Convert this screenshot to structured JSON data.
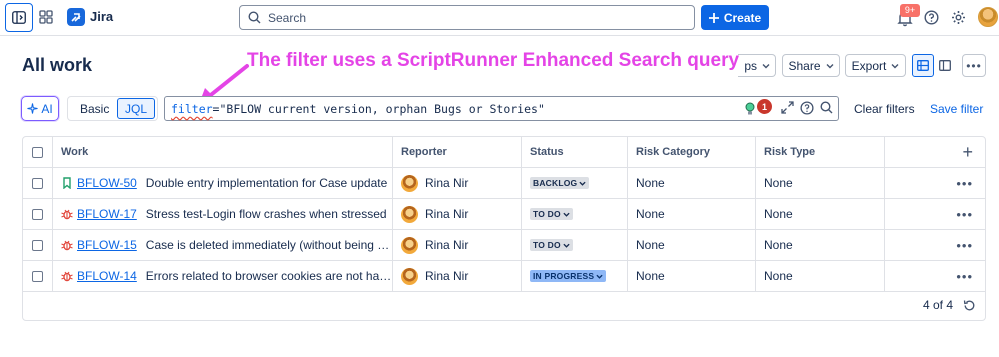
{
  "app": {
    "name": "Jira"
  },
  "topbar": {
    "search_placeholder": "Search",
    "create_label": "Create",
    "notification_count": "9+"
  },
  "page": {
    "title": "All work",
    "annotation": "The filter uses a ScriptRunner Enhanced Search query"
  },
  "header_buttons": {
    "apps": "ps",
    "share": "Share",
    "export": "Export"
  },
  "query": {
    "ai_label": "AI",
    "basic_label": "Basic",
    "jql_label": "JQL",
    "keyword": "filter",
    "rest": "=\"BFLOW current version, orphan Bugs or Stories\"",
    "error_count": "1",
    "clear_filters": "Clear filters",
    "save_filter": "Save filter"
  },
  "table": {
    "columns": [
      "Work",
      "Reporter",
      "Status",
      "Risk Category",
      "Risk Type"
    ],
    "rows": [
      {
        "type": "story",
        "key": "BFLOW-50",
        "summary": "Double entry implementation for Case update",
        "reporter": "Rina Nir",
        "status": "BACKLOG",
        "risk_category": "None",
        "risk_type": "None"
      },
      {
        "type": "bug",
        "key": "BFLOW-17",
        "summary": "Stress test-Login flow crashes when stressed",
        "reporter": "Rina Nir",
        "status": "TO DO",
        "risk_category": "None",
        "risk_type": "None"
      },
      {
        "type": "bug",
        "key": "BFLOW-15",
        "summary": "Case is deleted immediately (without being trash...",
        "reporter": "Rina Nir",
        "status": "TO DO",
        "risk_category": "None",
        "risk_type": "None"
      },
      {
        "type": "bug",
        "key": "BFLOW-14",
        "summary": "Errors related to browser cookies are not handled...",
        "reporter": "Rina Nir",
        "status": "IN PROGRESS",
        "risk_category": "None",
        "risk_type": "None"
      }
    ],
    "footer_count": "4 of 4"
  },
  "colors": {
    "accent": "#0c66e4",
    "annotation": "#e444e6",
    "bug": "#e2483d",
    "story": "#22a06b",
    "in_progress": "#8fb8f6"
  },
  "icons": [
    "sidebar-toggle-icon",
    "apps-grid-icon",
    "jira-logo-icon",
    "search-icon",
    "plus-icon",
    "bell-icon",
    "help-icon",
    "gear-icon",
    "chevron-down-icon",
    "list-view-icon",
    "detail-view-icon",
    "sparkle-icon",
    "lightbulb-icon",
    "expand-icon",
    "story-icon",
    "bug-icon",
    "refresh-icon"
  ]
}
